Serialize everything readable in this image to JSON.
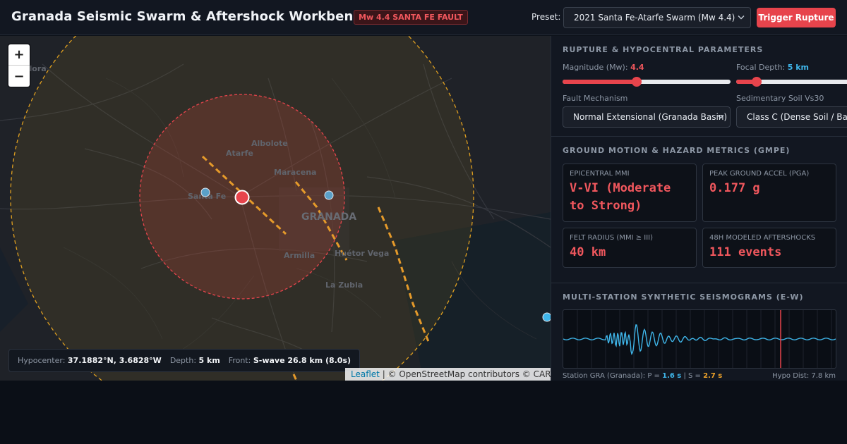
{
  "header": {
    "title": "Granada Seismic Swarm & Aftershock Workbench",
    "badge": "Mw 4.4 SANTA FE FAULT",
    "preset_label": "Preset:",
    "preset_value": "2021 Santa Fe-Atarfe Swarm (Mw 4.4)",
    "trigger_label": "Trigger Rupture",
    "colors": {
      "accent": "#e7444c",
      "badge_text": "#f0575d"
    }
  },
  "map": {
    "zoom_in": "+",
    "zoom_out": "−",
    "place_labels": {
      "albolote": "Albolote",
      "atarfe": "Atarfe",
      "maracena": "Maracena",
      "santa_fe": "Santa Fe",
      "granada": "GRANADA",
      "armilla": "Armilla",
      "huetor_vega": "Huétor Vega",
      "la_zubia": "La Zubia",
      "pinos": "illora"
    },
    "readout": {
      "hypocenter_label": "Hypocenter:",
      "hypocenter_value": "37.1882°N, 3.6828°W",
      "depth_label": "Depth:",
      "depth_value": "5 km",
      "front_label": "Front:",
      "front_value": "S-wave 26.8 km (8.0s)"
    },
    "attribution": {
      "leaflet": "Leaflet",
      "rest": "| © OpenStreetMap contributors © CARTO"
    },
    "colors": {
      "fault": "#e59a2a",
      "inner_ring": "#e7444c",
      "outer_ring": "#e0a020",
      "station": "#5aa0c8",
      "epicenter": "#e7444c"
    }
  },
  "panel": {
    "rupture": {
      "title": "RUPTURE & HYPOCENTRAL PARAMETERS",
      "magnitude_label": "Magnitude (Mw):",
      "magnitude_value": "4.4",
      "magnitude_fraction": 0.44,
      "depth_label": "Focal Depth:",
      "depth_value": "5 km",
      "depth_fraction": 0.12,
      "mechanism_label": "Fault Mechanism",
      "mechanism_value": "Normal Extensional (Granada Basin)",
      "soil_label": "Sedimentary Soil Vs30",
      "soil_value": "Class C (Dense Soil / Basin)"
    },
    "ground_motion": {
      "title": "GROUND MOTION & HAZARD METRICS (GMPE)",
      "cards": [
        {
          "label": "EPICENTRAL MMI",
          "value": "V-VI (Moderate to Strong)"
        },
        {
          "label": "PEAK GROUND ACCEL (PGA)",
          "value": "0.177 g"
        },
        {
          "label": "FELT RADIUS (MMI ≥ III)",
          "value": "40 km"
        },
        {
          "label": "48H MODELED AFTERSHOCKS",
          "value": "111 events"
        }
      ]
    },
    "seismograms": {
      "title": "MULTI-STATION SYNTHETIC SEISMOGRAMS (E-W)",
      "station_prefix": "Station GRA (Granada): P =",
      "p_value": "1.6 s",
      "sep": "| S =",
      "s_value": "2.7 s",
      "hypo_dist": "Hypo Dist: 7.8 km",
      "colors": {
        "trace": "#3fb6ea",
        "marker": "#e7444c"
      }
    }
  }
}
